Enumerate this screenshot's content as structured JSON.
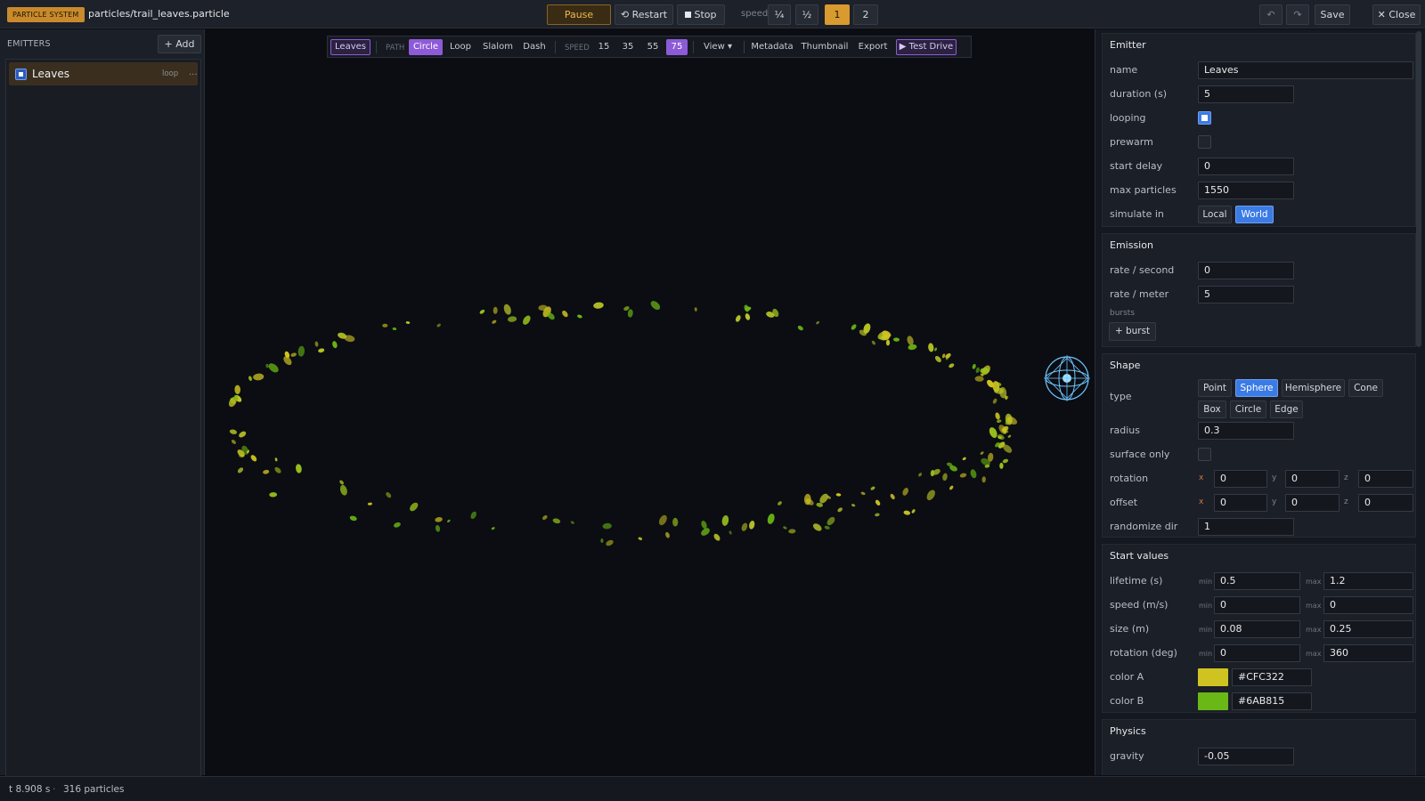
{
  "topbar": {
    "badge": "PARTICLE SYSTEM",
    "file_path": "particles/trail_leaves.particle",
    "pause_label": "Pause",
    "restart_label": "Restart",
    "stop_label": "Stop",
    "speed_label": "speed",
    "speed_options": [
      "¼",
      "½",
      "1",
      "2"
    ],
    "speed_selected": "1",
    "save_label": "Save",
    "close_label": "Close"
  },
  "left_panel": {
    "title": "EMITTERS",
    "add_label": "+ Add",
    "emitters": [
      {
        "name": "Leaves",
        "tag": "loop",
        "more": "..."
      }
    ]
  },
  "viewport_toolbar": {
    "emitter_label": "Leaves",
    "path_label": "PATH",
    "path_options": [
      "Circle",
      "Loop",
      "Slalom",
      "Dash"
    ],
    "path_selected": "Circle",
    "speed_label": "SPEED",
    "speed_options": [
      "15",
      "35",
      "55",
      "75"
    ],
    "speed_selected": "75",
    "view_label": "View ▾",
    "metadata_label": "Metadata",
    "thumbnail_label": "Thumbnail",
    "export_label": "Export",
    "test_drive_label": "▶ Test Drive"
  },
  "inspector": {
    "emitter": {
      "title": "Emitter",
      "name_label": "name",
      "name_value": "Leaves",
      "duration_label": "duration (s)",
      "duration_value": "5",
      "looping_label": "looping",
      "looping_value": true,
      "prewarm_label": "prewarm",
      "prewarm_value": false,
      "start_delay_label": "start delay",
      "start_delay_value": "0",
      "max_particles_label": "max particles",
      "max_particles_value": "1550",
      "simulate_label": "simulate in",
      "simulate_options": [
        "Local",
        "World"
      ],
      "simulate_selected": "World"
    },
    "emission": {
      "title": "Emission",
      "rate_second_label": "rate / second",
      "rate_second_value": "0",
      "rate_meter_label": "rate / meter",
      "rate_meter_value": "5",
      "bursts_label": "bursts",
      "add_burst_label": "+ burst"
    },
    "shape": {
      "title": "Shape",
      "type_label": "type",
      "types": [
        "Point",
        "Sphere",
        "Hemisphere",
        "Cone",
        "Box",
        "Circle",
        "Edge"
      ],
      "type_selected": "Sphere",
      "radius_label": "radius",
      "radius_value": "0.3",
      "surface_only_label": "surface only",
      "surface_only_value": false,
      "rotation_label": "rotation",
      "rotation": {
        "x": "0",
        "y": "0",
        "z": "0"
      },
      "offset_label": "offset",
      "offset": {
        "x": "0",
        "y": "0",
        "z": "0"
      },
      "randomize_label": "randomize dir",
      "randomize_value": "1",
      "axis_x": "x",
      "axis_y": "y",
      "axis_z": "z"
    },
    "start_values": {
      "title": "Start values",
      "min_label": "min",
      "max_label": "max",
      "lifetime_label": "lifetime (s)",
      "lifetime_min": "0.5",
      "lifetime_max": "1.2",
      "speed_label": "speed (m/s)",
      "speed_min": "0",
      "speed_max": "0",
      "size_label": "size (m)",
      "size_min": "0.08",
      "size_max": "0.25",
      "rotation_label": "rotation (deg)",
      "rotation_min": "0",
      "rotation_max": "360",
      "color_a_label": "color A",
      "color_a": "#CFC322",
      "color_b_label": "color B",
      "color_b": "#6AB815"
    },
    "physics": {
      "title": "Physics",
      "gravity_label": "gravity",
      "gravity_value": "-0.05"
    }
  },
  "status": {
    "time": "t 8.908 s",
    "sep": "·",
    "particles": "316 particles"
  },
  "colors": {
    "accent_orange": "#d99a2f",
    "accent_purple": "#8d5bd8",
    "accent_blue": "#3b7be6",
    "leaf_a": "#CFC322",
    "leaf_b": "#6AB815"
  }
}
